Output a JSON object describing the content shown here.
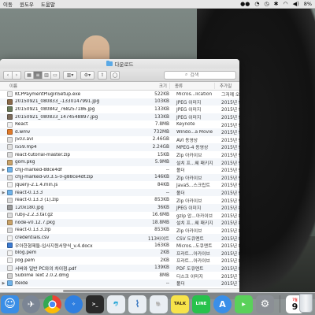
{
  "menubar": {
    "items": [
      "이동",
      "윈도우",
      "도움말"
    ],
    "battery": "8%"
  },
  "finder": {
    "title": "다운로드",
    "search_placeholder": "검색",
    "columns": {
      "name": "이름",
      "size": "크기",
      "kind": "종류",
      "date": "추가일"
    },
    "files": [
      {
        "name": "KCPPaymentPluginSetup.exe",
        "size": "522KB",
        "kind": "Micros...lication",
        "date": "그저께 오후 4:",
        "icon": "exe",
        "color": "#e9e9e9",
        "folder": false
      },
      {
        "name": "20150921_080833_-1330147991.jpg",
        "size": "103KB",
        "kind": "JPEG 이미지",
        "date": "2015년 9월",
        "icon": "jpg",
        "color": "#8a6a4a",
        "folder": false
      },
      {
        "name": "20150921_080842_768257186.jpg",
        "size": "133KB",
        "kind": "JPEG 이미지",
        "date": "2015년 9월",
        "icon": "jpg",
        "color": "#6a7a5a",
        "folder": false
      },
      {
        "name": "20150921_080833_1474548897.jpg",
        "size": "133KB",
        "kind": "JPEG 이미지",
        "date": "2015년 9월",
        "icon": "jpg",
        "color": "#7a6a5a",
        "folder": false
      },
      {
        "name": "React",
        "size": "7.8MB",
        "kind": "Keynote",
        "date": "2015년 9월",
        "icon": "keynote",
        "color": "#f0f0f0",
        "folder": false
      },
      {
        "name": "d.wmv",
        "size": "732MB",
        "kind": "Windo...a Movie",
        "date": "2015년 9월",
        "icon": "wmv",
        "color": "#e07a2a",
        "folder": false
      },
      {
        "name": "j503.avi",
        "size": "2.46GB",
        "kind": "AVI 동영상",
        "date": "2015년 9월",
        "icon": "avi",
        "color": "#e0e0e0",
        "folder": false
      },
      {
        "name": "i559.mp4",
        "size": "2.24GB",
        "kind": "MPEG-4 동영상",
        "date": "2015년 9월",
        "icon": "mp4",
        "color": "#e0e0e0",
        "folder": false
      },
      {
        "name": "react-tutorial-master.zip",
        "size": "15KB",
        "kind": "Zip 아카이브",
        "date": "2015년 9월",
        "icon": "zip",
        "color": "#dcdcdc",
        "folder": false
      },
      {
        "name": "gom.pkg",
        "size": "5.9MB",
        "kind": "설치 프...웨 패키지",
        "date": "2015년 9월",
        "icon": "pkg",
        "color": "#c9a36a",
        "folder": false
      },
      {
        "name": "chjj-marked-88ce4df",
        "size": "--",
        "kind": "폴더",
        "date": "2015년 9월",
        "icon": "folder",
        "color": "#6fb3ea",
        "folder": true
      },
      {
        "name": "chjj-marked-v0.3.5-0-g88ce4df.zip",
        "size": "146KB",
        "kind": "Zip 아카이브",
        "date": "2015년 9월",
        "icon": "zip",
        "color": "#dcdcdc",
        "folder": false
      },
      {
        "name": "jquery-2.1.4.min.js",
        "size": "84KB",
        "kind": "JavaS...스크립트",
        "date": "2015년 9월",
        "icon": "js",
        "color": "#f2f2f2",
        "folder": false
      },
      {
        "name": "react-0.13.3",
        "size": "--",
        "kind": "폴더",
        "date": "2015년 9월",
        "icon": "folder",
        "color": "#6fb3ea",
        "folder": true
      },
      {
        "name": "react-0.13.3 (1).zip",
        "size": "853KB",
        "kind": "Zip 아카이브",
        "date": "2015년 9월",
        "icon": "zip",
        "color": "#dcdcdc",
        "folder": false
      },
      {
        "name": "120x180.jpg",
        "size": "36KB",
        "kind": "JPEG 이미지",
        "date": "2015년 8월",
        "icon": "jpg",
        "color": "#9a9a9a",
        "folder": false
      },
      {
        "name": "ruby-2.2.3.tar.gz",
        "size": "16.6MB",
        "kind": "gzip 압...아카이브",
        "date": "2015년 8월",
        "icon": "gz",
        "color": "#dcdcdc",
        "folder": false
      },
      {
        "name": "node-v0.12.7.pkg",
        "size": "18.8MB",
        "kind": "설치 프...웨 패키지",
        "date": "2015년 8월",
        "icon": "pkg",
        "color": "#c9a36a",
        "folder": false
      },
      {
        "name": "react-0.13.3.zip",
        "size": "853KB",
        "kind": "Zip 아카이브",
        "date": "2015년 8월",
        "icon": "zip",
        "color": "#dcdcdc",
        "folder": false
      },
      {
        "name": "credentials.csv",
        "size": "113바이트",
        "kind": "CSV 도큐멘트",
        "date": "2015년 8월",
        "icon": "csv",
        "color": "#f2f2f2",
        "folder": false
      },
      {
        "name": "우아한형제들-입사지원서양식_v.4.docx",
        "size": "163KB",
        "kind": "Micros...도큐멘트",
        "date": "2015년 8월",
        "icon": "docx",
        "color": "#3d7bd1",
        "folder": false
      },
      {
        "name": "blog.pem",
        "size": "2KB",
        "kind": "프라트...아카이브",
        "date": "2015년 8월",
        "icon": "pem",
        "color": "#f2f2f2",
        "folder": false
      },
      {
        "name": "jlog.pem",
        "size": "2KB",
        "kind": "프라트...아카이브",
        "date": "2015년 8월",
        "icon": "pem",
        "color": "#f2f2f2",
        "folder": false
      },
      {
        "name": "서버와 일반 PC와의 차이점.pdf",
        "size": "139KB",
        "kind": "PDF 도큐멘트",
        "date": "2015년 8월",
        "icon": "pdf",
        "color": "#e8e8e8",
        "folder": false
      },
      {
        "name": "Sublime Text 2.0.2.dmg",
        "size": "8MB",
        "kind": "디스크 이미지",
        "date": "2015년 7월",
        "icon": "dmg",
        "color": "#d0d0d0",
        "folder": false
      },
      {
        "name": "Iteide",
        "size": "--",
        "kind": "폴더",
        "date": "2015년 7월",
        "icon": "folder",
        "color": "#6fb3ea",
        "folder": true
      }
    ]
  },
  "dock": {
    "items": [
      {
        "name": "finder",
        "color": "#3a8ee6"
      },
      {
        "name": "launchpad",
        "color": "#7b8594"
      },
      {
        "name": "chrome",
        "color": "#e9e9e9"
      },
      {
        "name": "safari",
        "color": "#2f7fe0"
      },
      {
        "name": "terminal",
        "color": "#2a2a2a"
      },
      {
        "name": "mysql-workbench",
        "color": "#e9eef3"
      },
      {
        "name": "sourcetree",
        "color": "#e9eef3"
      },
      {
        "name": "evernote",
        "color": "#e9eef3"
      },
      {
        "name": "kakaotalk",
        "color": "#f7e34a",
        "label": "TALK"
      },
      {
        "name": "line",
        "color": "#27c24c",
        "label": "LINE"
      },
      {
        "name": "app-store",
        "color": "#3a8fe8"
      },
      {
        "name": "facetime",
        "color": "#5ad15a"
      },
      {
        "name": "system-preferences",
        "color": "#8b8f95"
      },
      {
        "name": "calendar",
        "color": "#ffffff",
        "day": "9",
        "month": "7월"
      }
    ]
  }
}
